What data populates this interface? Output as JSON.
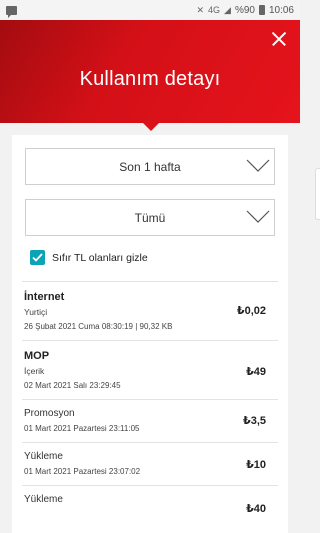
{
  "status_bar": {
    "network": "4G",
    "battery": "%90",
    "time": "10:06"
  },
  "header": {
    "title": "Kullanım detayı"
  },
  "filters": {
    "period": "Son 1 hafta",
    "category": "Tümü",
    "hide_zero_label": "Sıfır TL olanları gizle",
    "hide_zero_checked": true
  },
  "usage_items": [
    {
      "title": "İnternet",
      "subtitle": "Yurtiçi",
      "date": "26 Şubat 2021 Cuma 08:30:19 | 90,32 KB",
      "amount": "₺0,02"
    },
    {
      "title": "MOP",
      "subtitle": "İçerik",
      "date": "02 Mart 2021 Salı 23:29:45",
      "amount": "₺49"
    },
    {
      "title": "Promosyon",
      "subtitle": "",
      "date": "01 Mart 2021 Pazartesi 23:11:05",
      "amount": "₺3,5"
    },
    {
      "title": "Yükleme",
      "subtitle": "",
      "date": "01 Mart 2021 Pazartesi 23:07:02",
      "amount": "₺10"
    },
    {
      "title": "Yükleme",
      "subtitle": "",
      "date": "",
      "amount": "₺40"
    }
  ]
}
